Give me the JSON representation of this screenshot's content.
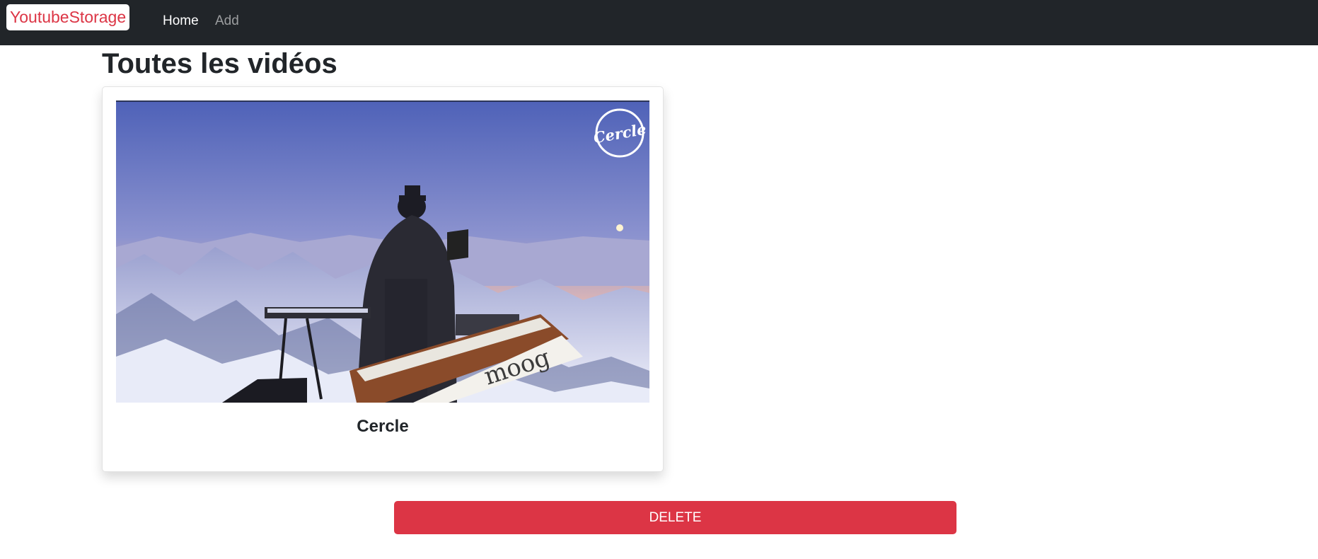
{
  "navbar": {
    "brand": "YoutubeStorage",
    "links": [
      {
        "label": "Home",
        "active": true
      },
      {
        "label": "Add",
        "active": false
      }
    ]
  },
  "page": {
    "title": "Toutes les vidéos"
  },
  "videos": [
    {
      "title": "Cercle",
      "thumbnail_logo": "Cercle",
      "thumbnail_keyboard_brand": "moog"
    }
  ],
  "actions": {
    "delete_label": "DELETE"
  },
  "colors": {
    "navbar_bg": "#212529",
    "brand_text": "#dc3545",
    "danger": "#dc3545"
  }
}
